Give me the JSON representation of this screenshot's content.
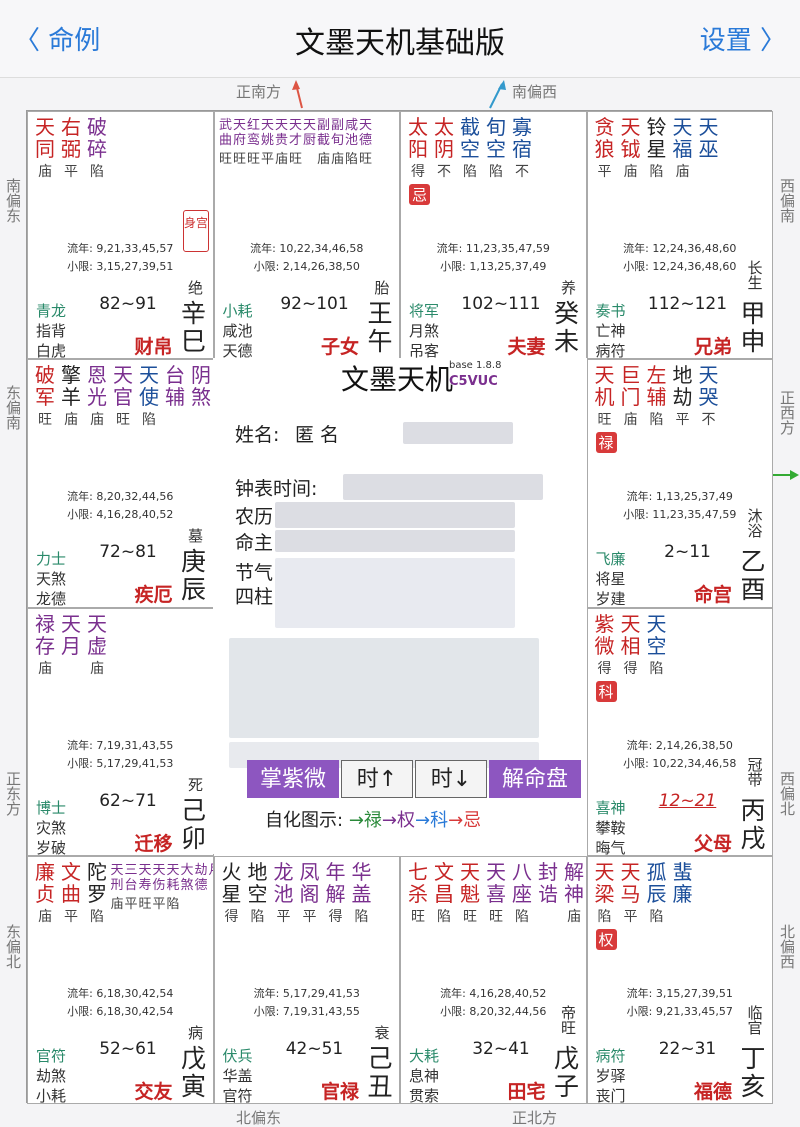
{
  "nav": {
    "back": "〈 命例",
    "title": "文墨天机基础版",
    "settings": "设置 〉"
  },
  "dirs": {
    "top_left": "正南方",
    "top_right": "南偏西",
    "left1": "南偏东",
    "left2": "东偏南",
    "left3": "正东方",
    "left4": "东偏北",
    "right1": "西偏南",
    "right2": "正西方",
    "right3": "西偏北",
    "right4": "北偏西",
    "bottom_left": "北偏东",
    "bottom_right": "正北方"
  },
  "colors": {
    "red": "#c62424",
    "purple": "#7a2f8e",
    "blue": "#1c4f9a",
    "green": "#2a8a6a",
    "lu": "#d83a3a",
    "quan": "#d83a3a",
    "ke": "#d83a3a"
  },
  "palaces": [
    {
      "id": "si",
      "stars": [
        {
          "n": "天同",
          "c": "#c62424",
          "b": "庙"
        },
        {
          "n": "右弼",
          "c": "#c62424",
          "b": "平"
        },
        {
          "n": "破碎",
          "c": "#7a2f8e",
          "b": "陷"
        }
      ],
      "shen": "身宫",
      "liunian": "流年: 9,21,33,45,57",
      "xiaoxian": "小限: 3,15,27,39,51",
      "god1": "青龙",
      "god2": "指背",
      "god3": "白虎",
      "limit": "82~91",
      "stage": "绝",
      "gz1": "辛",
      "gz2": "巳",
      "palace": "财帛"
    },
    {
      "id": "wu",
      "small": [
        "武曲",
        "天府",
        "红鸾",
        "天姚",
        "天贵",
        "天才",
        "天厨",
        "副截",
        "副旬",
        "咸池",
        "天德"
      ],
      "smallb": [
        "旺",
        "旺",
        "旺",
        "平",
        "庙",
        "旺",
        "",
        "庙",
        "庙",
        "陷",
        "旺"
      ],
      "liunian": "流年: 10,22,34,46,58",
      "xiaoxian": "小限: 2,14,26,38,50",
      "god1": "小耗",
      "god2": "咸池",
      "god3": "天德",
      "limit": "92~101",
      "stage": "胎",
      "gz1": "王",
      "gz2": "午",
      "palace": "子女"
    },
    {
      "id": "wei",
      "stars": [
        {
          "n": "太阳",
          "c": "#c62424",
          "b": "得"
        },
        {
          "n": "太阴",
          "c": "#c62424",
          "b": "不"
        },
        {
          "n": "截空",
          "c": "#1c4f9a",
          "b": "陷"
        },
        {
          "n": "旬空",
          "c": "#1c4f9a",
          "b": "陷"
        },
        {
          "n": "寡宿",
          "c": "#1c4f9a",
          "b": "不"
        }
      ],
      "tag": "忌",
      "liunian": "流年: 11,23,35,47,59",
      "xiaoxian": "小限: 1,13,25,37,49",
      "god1": "将军",
      "god2": "月煞",
      "god3": "吊客",
      "limit": "102~111",
      "stage": "养",
      "gz1": "癸",
      "gz2": "未",
      "palace": "夫妻"
    },
    {
      "id": "shen",
      "stars": [
        {
          "n": "贪狼",
          "c": "#c62424",
          "b": "平"
        },
        {
          "n": "天钺",
          "c": "#c62424",
          "b": "庙"
        },
        {
          "n": "铃星",
          "c": "#222",
          "b": "陷"
        },
        {
          "n": "天福",
          "c": "#1c4f9a",
          "b": "庙"
        },
        {
          "n": "天巫",
          "c": "#1c4f9a",
          "b": ""
        }
      ],
      "liunian": "流年: 12,24,36,48,60",
      "xiaoxian": "小限: 12,24,36,48,60",
      "god1": "奏书",
      "god2": "亡神",
      "god3": "病符",
      "limit": "112~121",
      "stage": "长生",
      "gz1": "甲",
      "gz2": "申",
      "palace": "兄弟"
    },
    {
      "id": "chen",
      "stars": [
        {
          "n": "破军",
          "c": "#c62424",
          "b": "旺"
        },
        {
          "n": "擎羊",
          "c": "#222",
          "b": "庙"
        },
        {
          "n": "恩光",
          "c": "#7a2f8e",
          "b": "庙"
        },
        {
          "n": "天官",
          "c": "#7a2f8e",
          "b": "旺"
        },
        {
          "n": "天使",
          "c": "#1c4f9a",
          "b": "陷"
        },
        {
          "n": "台辅",
          "c": "#7a2f8e",
          "b": ""
        },
        {
          "n": "阴煞",
          "c": "#7a2f8e",
          "b": ""
        },
        {
          "n": "龙德",
          "c": "#7a2f8e",
          "b": ""
        }
      ],
      "liunian": "流年: 8,20,32,44,56",
      "xiaoxian": "小限: 4,16,28,40,52",
      "god1": "力士",
      "god2": "天煞",
      "god3": "龙德",
      "limit": "72~81",
      "stage": "墓",
      "gz1": "庚",
      "gz2": "辰",
      "palace": "疾厄"
    },
    {
      "id": "you",
      "stars": [
        {
          "n": "天机",
          "c": "#c62424",
          "b": "旺"
        },
        {
          "n": "巨门",
          "c": "#c62424",
          "b": "庙"
        },
        {
          "n": "左辅",
          "c": "#c62424",
          "b": "陷"
        },
        {
          "n": "地劫",
          "c": "#222",
          "b": "平"
        },
        {
          "n": "天哭",
          "c": "#1c4f9a",
          "b": "不"
        }
      ],
      "tag": "禄",
      "liunian": "流年: 1,13,25,37,49",
      "xiaoxian": "小限: 11,23,35,47,59",
      "god1": "飞廉",
      "god2": "将星",
      "god3": "岁建",
      "limit": "2~11",
      "stage": "沐浴",
      "gz1": "乙",
      "gz2": "酉",
      "palace": "命宫"
    },
    {
      "id": "mao",
      "stars": [
        {
          "n": "禄存",
          "c": "#7a2f8e",
          "b": "庙"
        },
        {
          "n": "天月",
          "c": "#7a2f8e",
          "b": ""
        },
        {
          "n": "天虚",
          "c": "#7a2f8e",
          "b": "庙"
        }
      ],
      "liunian": "流年: 7,19,31,43,55",
      "xiaoxian": "小限: 5,17,29,41,53",
      "god1": "博士",
      "god2": "灾煞",
      "god3": "岁破",
      "limit": "62~71",
      "stage": "死",
      "gz1": "己",
      "gz2": "卯",
      "palace": "迁移"
    },
    {
      "id": "xu",
      "stars": [
        {
          "n": "紫微",
          "c": "#c62424",
          "b": "得"
        },
        {
          "n": "天相",
          "c": "#c62424",
          "b": "得"
        },
        {
          "n": "天空",
          "c": "#1c4f9a",
          "b": "陷"
        }
      ],
      "tag": "科",
      "liunian": "流年: 2,14,26,38,50",
      "xiaoxian": "小限: 10,22,34,46,58",
      "god1": "喜神",
      "god2": "攀鞍",
      "god3": "晦气",
      "limit": "12~21",
      "stage": "冠带",
      "gz1": "丙",
      "gz2": "戌",
      "palace": "父母"
    },
    {
      "id": "yin",
      "stars": [
        {
          "n": "廉贞",
          "c": "#c62424",
          "b": "庙"
        },
        {
          "n": "文曲",
          "c": "#c62424",
          "b": "平"
        },
        {
          "n": "陀罗",
          "c": "#222",
          "b": "陷"
        }
      ],
      "small": [
        "天刑",
        "三台",
        "天寿",
        "天伤",
        "天耗",
        "大煞",
        "劫德",
        "月"
      ],
      "smallb": [
        "庙",
        "平",
        "旺",
        "平",
        "陷",
        "",
        "",
        ""
      ],
      "liunian": "流年: 6,18,30,42,54",
      "xiaoxian": "小限: 6,18,30,42,54",
      "god1": "官符",
      "god2": "劫煞",
      "god3": "小耗",
      "limit": "52~61",
      "stage": "病",
      "gz1": "戊",
      "gz2": "寅",
      "palace": "交友"
    },
    {
      "id": "chou",
      "stars": [
        {
          "n": "火星",
          "c": "#222",
          "b": "得"
        },
        {
          "n": "地空",
          "c": "#222",
          "b": "陷"
        },
        {
          "n": "龙池",
          "c": "#7a2f8e",
          "b": "平"
        },
        {
          "n": "凤阁",
          "c": "#7a2f8e",
          "b": "平"
        },
        {
          "n": "年解",
          "c": "#7a2f8e",
          "b": "得"
        },
        {
          "n": "华盖",
          "c": "#7a2f8e",
          "b": "陷"
        }
      ],
      "liunian": "流年: 5,17,29,41,53",
      "xiaoxian": "小限: 7,19,31,43,55",
      "god1": "伏兵",
      "god2": "华盖",
      "god3": "官符",
      "limit": "42~51",
      "stage": "衰",
      "gz1": "己",
      "gz2": "丑",
      "palace": "官禄"
    },
    {
      "id": "zi",
      "stars": [
        {
          "n": "七杀",
          "c": "#c62424",
          "b": "旺"
        },
        {
          "n": "文昌",
          "c": "#c62424",
          "b": "陷"
        },
        {
          "n": "天魁",
          "c": "#c62424",
          "b": "旺"
        },
        {
          "n": "天喜",
          "c": "#7a2f8e",
          "b": "旺"
        },
        {
          "n": "八座",
          "c": "#7a2f8e",
          "b": "陷"
        },
        {
          "n": "封诰",
          "c": "#7a2f8e",
          "b": ""
        },
        {
          "n": "解神",
          "c": "#7a2f8e",
          "b": "庙"
        }
      ],
      "liunian": "流年: 4,16,28,40,52",
      "xiaoxian": "小限: 8,20,32,44,56",
      "god1": "大耗",
      "god2": "息神",
      "god3": "贯索",
      "limit": "32~41",
      "stage": "帝旺",
      "gz1": "戊",
      "gz2": "子",
      "palace": "田宅"
    },
    {
      "id": "hai",
      "stars": [
        {
          "n": "天梁",
          "c": "#c62424",
          "b": "陷"
        },
        {
          "n": "天马",
          "c": "#c62424",
          "b": "平"
        },
        {
          "n": "孤辰",
          "c": "#1c4f9a",
          "b": "陷"
        },
        {
          "n": "蜚廉",
          "c": "#1c4f9a",
          "b": ""
        }
      ],
      "tag": "权",
      "liunian": "流年: 3,15,27,39,51",
      "xiaoxian": "小限: 9,21,33,45,57",
      "god1": "病符",
      "god2": "岁驿",
      "god3": "丧门",
      "limit": "22~31",
      "stage": "临官",
      "gz1": "丁",
      "gz2": "亥",
      "palace": "福德"
    }
  ],
  "center": {
    "title": "文墨天机",
    "version": "base 1.8.8",
    "code": "C5VUC",
    "name_label": "姓名:",
    "name_value": "匿 名",
    "clock_label": "钟表时间:",
    "lunar_label": "农历",
    "ming_label": "命主",
    "jieqi_label": "节气",
    "sizhu_label": "四柱",
    "btn1": "掌紫微",
    "btn2": "时↑",
    "btn3": "时↓",
    "btn4": "解命盘",
    "legend_label": "自化图示:",
    "legend_lu": "→禄",
    "legend_quan": "→权",
    "legend_ke": "→科",
    "legend_ji": "→忌"
  }
}
